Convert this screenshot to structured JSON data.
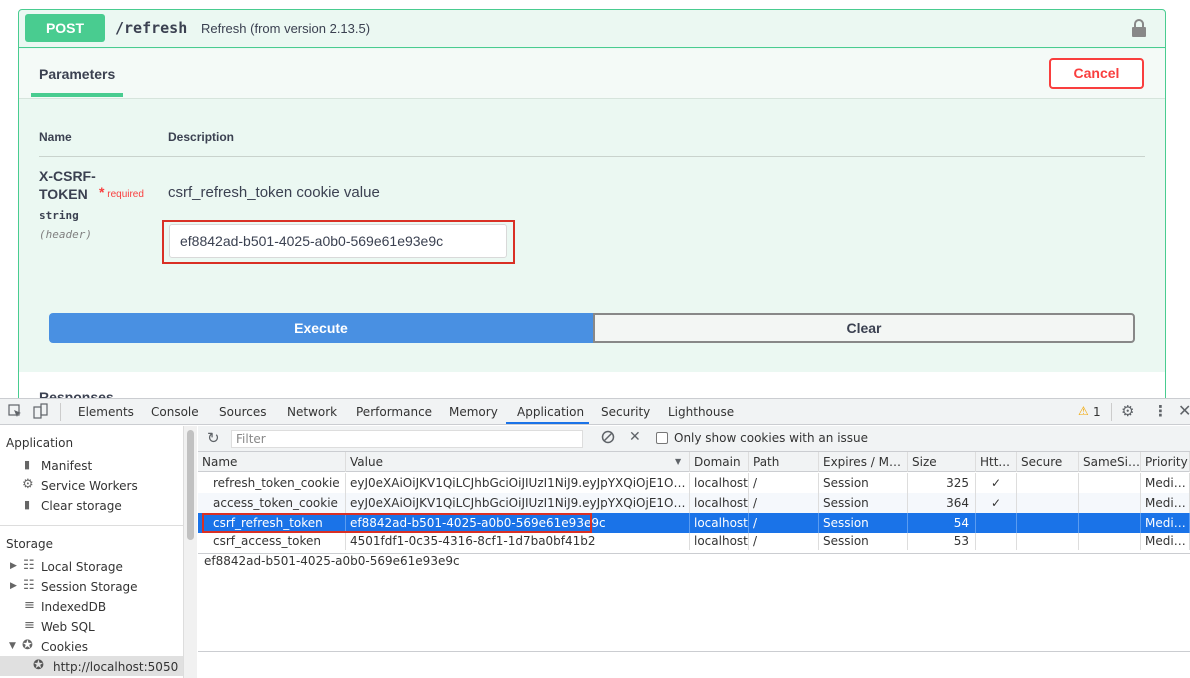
{
  "swagger": {
    "method": "POST",
    "path": "/refresh",
    "summary": "Refresh (from version 2.13.5)",
    "tab_parameters": "Parameters",
    "cancel_label": "Cancel",
    "col_name": "Name",
    "col_description": "Description",
    "param": {
      "name": "X-CSRF-TOKEN",
      "required_mark": "*",
      "required_label": "required",
      "type": "string",
      "location": "(header)",
      "description": "csrf_refresh_token cookie value",
      "value": "ef8842ad-b501-4025-a0b0-569e61e93e9c"
    },
    "execute_label": "Execute",
    "clear_label": "Clear",
    "responses_label": "Responses"
  },
  "devtools": {
    "tabs": [
      "Elements",
      "Console",
      "Sources",
      "Network",
      "Performance",
      "Memory",
      "Application",
      "Security",
      "Lighthouse"
    ],
    "active_tab": "Application",
    "warning_count": "1",
    "sidebar": {
      "application_header": "Application",
      "manifest": "Manifest",
      "service_workers": "Service Workers",
      "clear_storage": "Clear storage",
      "storage_header": "Storage",
      "local_storage": "Local Storage",
      "session_storage": "Session Storage",
      "indexeddb": "IndexedDB",
      "web_sql": "Web SQL",
      "cookies": "Cookies",
      "cookie_origin": "http://localhost:5050"
    },
    "toolbar": {
      "filter_placeholder": "Filter",
      "only_issue_label": "Only show cookies with an issue"
    },
    "columns": [
      "Name",
      "Value",
      "Domain",
      "Path",
      "Expires / Ma...",
      "Size",
      "Htt...",
      "Secure",
      "SameSite",
      "Priority"
    ],
    "rows": [
      {
        "name": "refresh_token_cookie",
        "value": "eyJ0eXAiOiJKV1QiLCJhbGciOiJIUzI1NiJ9.eyJpYXQiOjE1OT...",
        "domain": "localhost",
        "path": "/",
        "expires": "Session",
        "size": "325",
        "http": "✓",
        "secure": "",
        "samesite": "",
        "priority": "Medium"
      },
      {
        "name": "access_token_cookie",
        "value": "eyJ0eXAiOiJKV1QiLCJhbGciOiJIUzI1NiJ9.eyJpYXQiOjE1OT...",
        "domain": "localhost",
        "path": "/",
        "expires": "Session",
        "size": "364",
        "http": "✓",
        "secure": "",
        "samesite": "",
        "priority": "Medium"
      },
      {
        "name": "csrf_refresh_token",
        "value": "ef8842ad-b501-4025-a0b0-569e61e93e9c",
        "domain": "localhost",
        "path": "/",
        "expires": "Session",
        "size": "54",
        "http": "",
        "secure": "",
        "samesite": "",
        "priority": "Medium"
      },
      {
        "name": "csrf_access_token",
        "value": "4501fdf1-0c35-4316-8cf1-1d7ba0bf41b2",
        "domain": "localhost",
        "path": "/",
        "expires": "Session",
        "size": "53",
        "http": "",
        "secure": "",
        "samesite": "",
        "priority": "Medium"
      }
    ],
    "selected_row": 2,
    "preview_value": "ef8842ad-b501-4025-a0b0-569e61e93e9c"
  },
  "colors": {
    "post_green": "#49cc90",
    "execute_blue": "#4990e2",
    "cancel_red": "#f93e3e",
    "selection_blue": "#1a73e8",
    "highlight_red": "#d93025"
  }
}
